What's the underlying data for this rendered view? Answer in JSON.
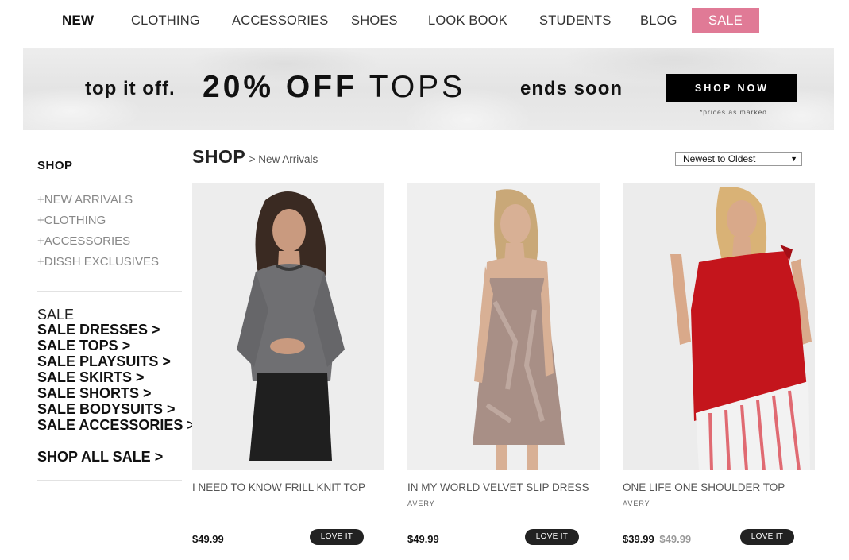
{
  "nav": {
    "items": [
      {
        "label": "NEW"
      },
      {
        "label": "CLOTHING"
      },
      {
        "label": "ACCESSORIES"
      },
      {
        "label": "SHOES"
      },
      {
        "label": "LOOK BOOK"
      },
      {
        "label": "STUDENTS"
      },
      {
        "label": "BLOG"
      },
      {
        "label": "SALE"
      }
    ],
    "sale_color": "#e07a96"
  },
  "banner": {
    "left_text": "top it off.",
    "main_bold": "20% OFF",
    "main_light": "TOPS",
    "right_text": "ends soon",
    "button_label": "SHOP NOW",
    "note": "*prices as marked"
  },
  "sidebar": {
    "title": "SHOP",
    "links": [
      "+NEW ARRIVALS",
      "+CLOTHING",
      "+ACCESSORIES",
      "+DISSH EXCLUSIVES"
    ],
    "sale_heading": "SALE",
    "sale_links": [
      "SALE DRESSES >",
      "SALE TOPS >",
      "SALE PLAYSUITS >",
      "SALE SKIRTS >",
      "SALE SHORTS >",
      "SALE BODYSUITS >",
      "SALE ACCESSORIES >"
    ],
    "shop_all_sale": "SHOP ALL SALE >"
  },
  "main": {
    "heading": "SHOP",
    "breadcrumb": "> New Arrivals",
    "sort": {
      "selected": "Newest to Oldest"
    }
  },
  "products": [
    {
      "name": "I NEED TO KNOW FRILL KNIT TOP",
      "brand": "",
      "price": "$49.99",
      "was_price": "",
      "button": "LOVE IT"
    },
    {
      "name": "IN MY WORLD VELVET SLIP DRESS",
      "brand": "AVERY",
      "price": "$49.99",
      "was_price": "",
      "button": "LOVE IT"
    },
    {
      "name": "ONE LIFE ONE SHOULDER TOP",
      "brand": "AVERY",
      "price": "$39.99",
      "was_price": "$49.99",
      "button": "LOVE IT"
    }
  ]
}
